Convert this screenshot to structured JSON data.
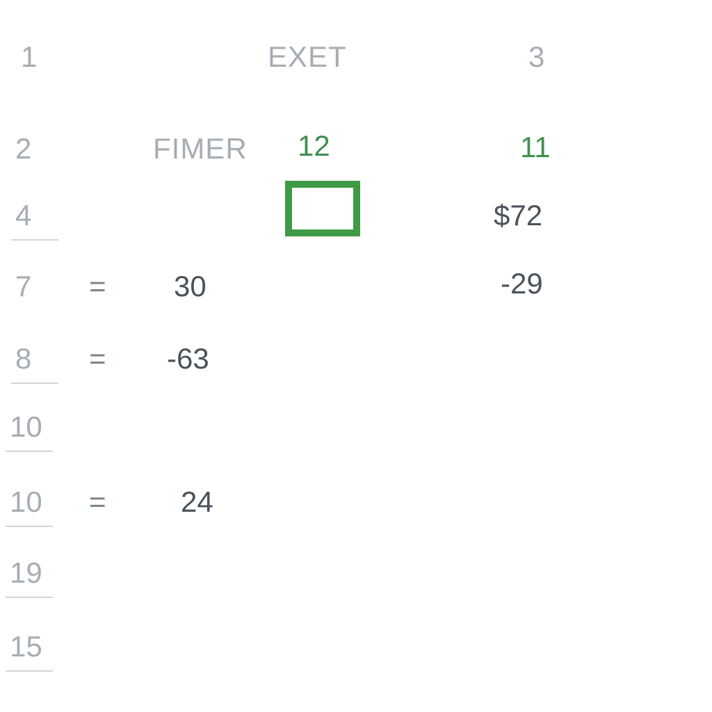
{
  "header": {
    "col1_label": "1",
    "col2_label": "EXET",
    "col3_label": "3"
  },
  "rows": [
    {
      "num": "2",
      "underlined": false,
      "eq": "",
      "colB": "FIMER",
      "colC": "12",
      "colD": "11",
      "colC_green": true,
      "colD_green": true
    },
    {
      "num": "4",
      "underlined": true,
      "eq": "",
      "colB": "",
      "colC": "",
      "colD": "$72",
      "colC_green": false,
      "colD_green": false
    },
    {
      "num": "7",
      "underlined": false,
      "eq": "=",
      "colB": "30",
      "colC": "",
      "colD": "-29",
      "colC_green": false,
      "colD_green": false
    },
    {
      "num": "8",
      "underlined": true,
      "eq": "=",
      "colB": "-63",
      "colC": "",
      "colD": "",
      "colC_green": false,
      "colD_green": false
    },
    {
      "num": "10",
      "underlined": true,
      "eq": "",
      "colB": "",
      "colC": "",
      "colD": "",
      "colC_green": false,
      "colD_green": false
    },
    {
      "num": "10",
      "underlined": true,
      "eq": "=",
      "colB": "24",
      "colC": "",
      "colD": "",
      "colC_green": false,
      "colD_green": false
    },
    {
      "num": "19",
      "underlined": true,
      "eq": "",
      "colB": "",
      "colC": "",
      "colD": "",
      "colC_green": false,
      "colD_green": false
    },
    {
      "num": "15",
      "underlined": true,
      "eq": "",
      "colB": "",
      "colC": "",
      "colD": "",
      "colC_green": false,
      "colD_green": false
    }
  ],
  "selection": {
    "row_index": 1
  }
}
